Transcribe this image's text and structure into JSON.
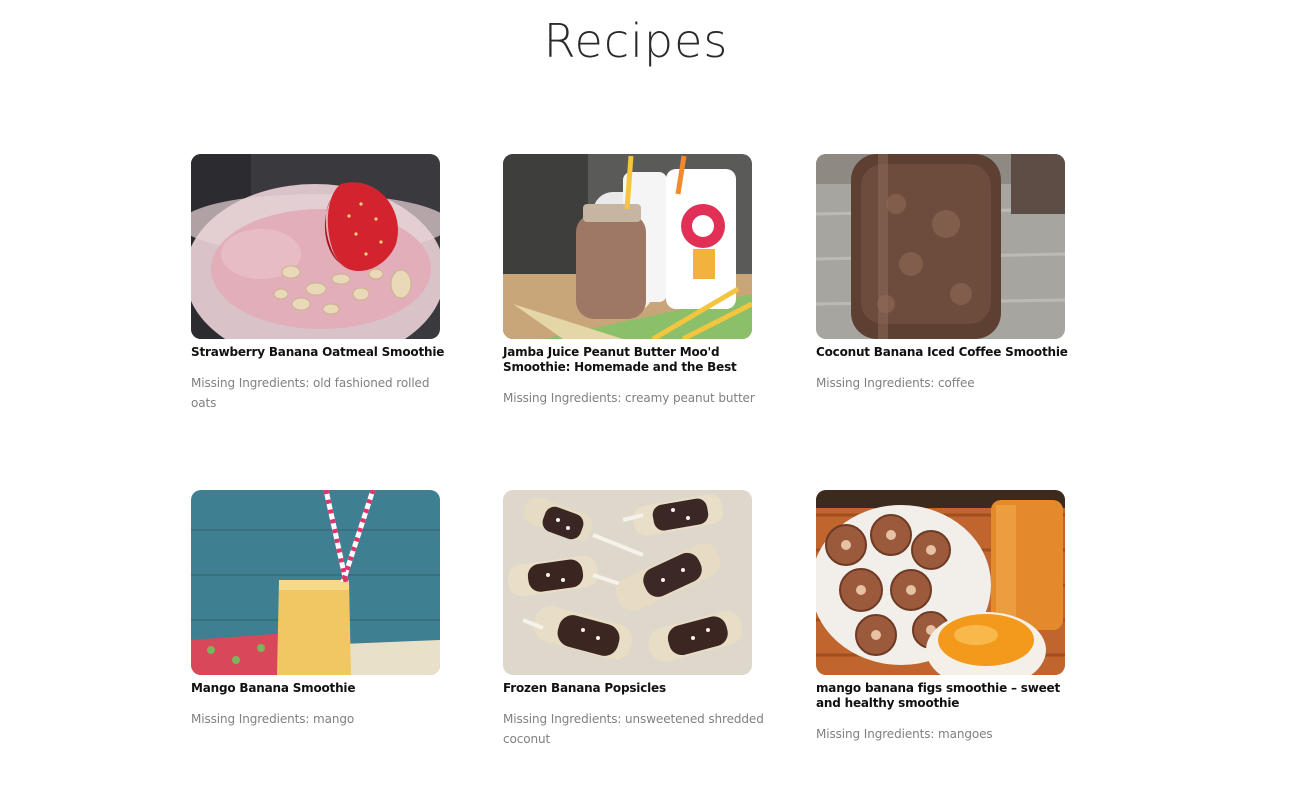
{
  "page": {
    "title": "Recipes"
  },
  "missing_prefix": "Missing Ingredients: ",
  "recipes": [
    {
      "title": "Strawberry Banana Oatmeal Smoothie",
      "missing": "Missing Ingredients: old fashioned rolled oats",
      "image": "strawberry-oat-smoothie"
    },
    {
      "title": "Jamba Juice Peanut Butter Moo'd Smoothie: Homemade and the Best",
      "missing": "Missing Ingredients: creamy peanut butter",
      "image": "jamba-smoothie"
    },
    {
      "title": "Coconut Banana Iced Coffee Smoothie",
      "missing": "Missing Ingredients: coffee",
      "image": "iced-coffee-jar"
    },
    {
      "title": "Mango Banana Smoothie",
      "missing": "Missing Ingredients: mango",
      "image": "mango-smoothie-glass"
    },
    {
      "title": "Frozen Banana Popsicles",
      "missing": "Missing Ingredients: unsweetened shredded coconut",
      "image": "banana-popsicles"
    },
    {
      "title": "mango banana figs smoothie – sweet and healthy smoothie",
      "missing": "Missing Ingredients: mangoes",
      "image": "figs-mango-smoothie"
    }
  ]
}
